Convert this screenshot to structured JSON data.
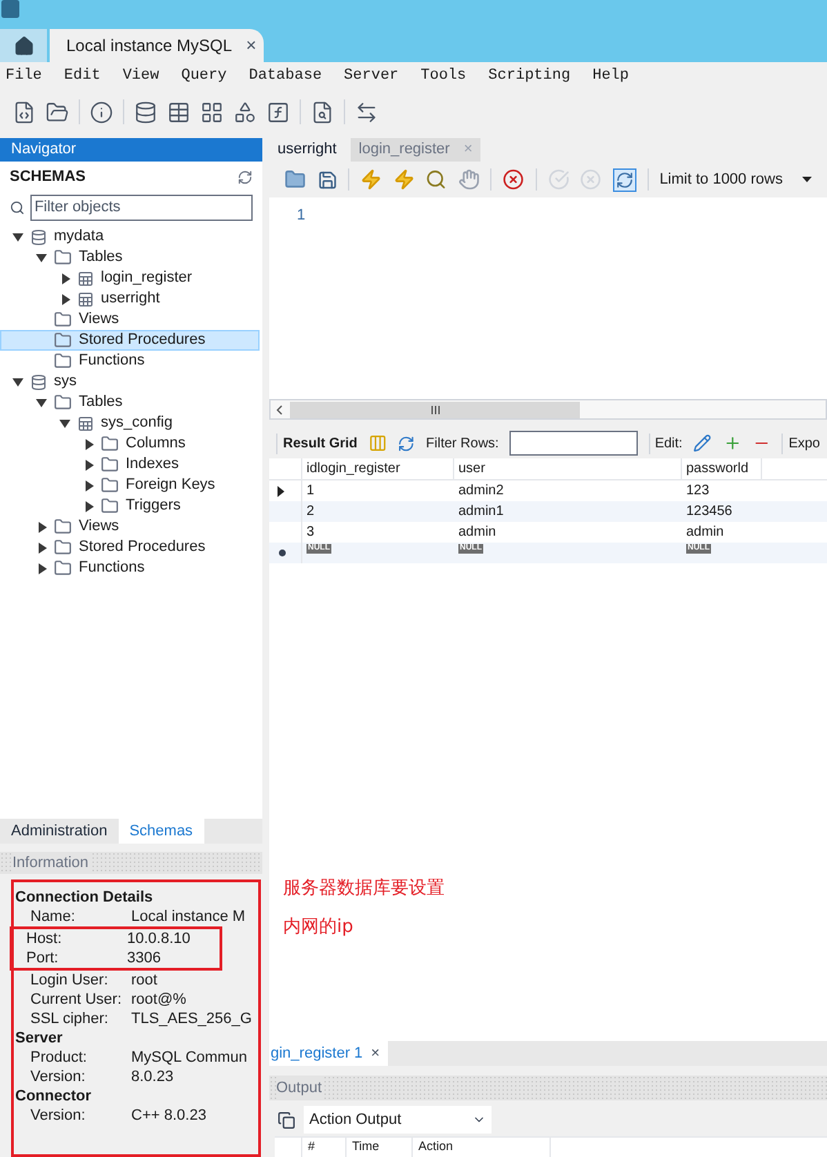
{
  "window": {
    "tabs": [
      {
        "kind": "home",
        "selected": false
      },
      {
        "kind": "doc",
        "label": "Local instance MySQL",
        "close": "×",
        "selected": true
      }
    ]
  },
  "menu": [
    "File",
    "Edit",
    "View",
    "Query",
    "Database",
    "Server",
    "Tools",
    "Scripting",
    "Help"
  ],
  "navigator": {
    "title": "Navigator",
    "schemas_label": "SCHEMAS",
    "filter": {
      "placeholder": "Filter objects"
    },
    "tree": [
      {
        "label": "mydata",
        "kind": "database",
        "expandable": true,
        "expanded": true,
        "selected": false,
        "children": [
          {
            "label": "Tables",
            "kind": "folder",
            "expandable": true,
            "expanded": true,
            "selected": false,
            "children": [
              {
                "label": "login_register",
                "kind": "table",
                "expandable": true,
                "expanded": false,
                "selected": false
              },
              {
                "label": "userright",
                "kind": "table",
                "expandable": true,
                "expanded": false,
                "selected": false
              }
            ]
          },
          {
            "label": "Views",
            "kind": "folder",
            "expandable": false,
            "selected": false
          },
          {
            "label": "Stored Procedures",
            "kind": "folder",
            "expandable": false,
            "selected": true
          },
          {
            "label": "Functions",
            "kind": "folder",
            "expandable": false,
            "selected": false
          }
        ]
      },
      {
        "label": "sys",
        "kind": "database",
        "expandable": true,
        "expanded": true,
        "selected": false,
        "children": [
          {
            "label": "Tables",
            "kind": "folder",
            "expandable": true,
            "expanded": true,
            "selected": false,
            "children": [
              {
                "label": "sys_config",
                "kind": "table",
                "expandable": true,
                "expanded": true,
                "selected": false,
                "children": [
                  {
                    "label": "Columns",
                    "kind": "folder",
                    "expandable": true,
                    "expanded": false,
                    "selected": false
                  },
                  {
                    "label": "Indexes",
                    "kind": "folder",
                    "expandable": true,
                    "expanded": false,
                    "selected": false
                  },
                  {
                    "label": "Foreign Keys",
                    "kind": "folder",
                    "expandable": true,
                    "expanded": false,
                    "selected": false
                  },
                  {
                    "label": "Triggers",
                    "kind": "folder",
                    "expandable": true,
                    "expanded": false,
                    "selected": false
                  }
                ]
              }
            ]
          },
          {
            "label": "Views",
            "kind": "folder",
            "expandable": true,
            "expanded": false,
            "selected": false
          },
          {
            "label": "Stored Procedures",
            "kind": "folder",
            "expandable": true,
            "expanded": false,
            "selected": false
          },
          {
            "label": "Functions",
            "kind": "folder",
            "expandable": true,
            "expanded": false,
            "selected": false
          }
        ]
      }
    ]
  },
  "side_tabs": [
    {
      "label": "Administration",
      "selected": false
    },
    {
      "label": "Schemas",
      "selected": true
    }
  ],
  "information": {
    "title": "Information",
    "sections": [
      {
        "title": "Connection Details",
        "rows": [
          {
            "label": "Name:",
            "value": "Local instance M",
            "annotated": false
          },
          {
            "label": "Host:",
            "value": "10.0.8.10",
            "annotated": true
          },
          {
            "label": "Port:",
            "value": "3306",
            "annotated": true
          },
          {
            "label": "Login User:",
            "value": "root",
            "annotated": false
          },
          {
            "label": "Current User:",
            "value": "root@%",
            "annotated": false
          },
          {
            "label": "SSL cipher:",
            "value": "TLS_AES_256_G",
            "annotated": false
          }
        ]
      },
      {
        "title": "Server",
        "rows": [
          {
            "label": "Product:",
            "value": "MySQL Commun",
            "annotated": false
          },
          {
            "label": "Version:",
            "value": "8.0.23",
            "annotated": false
          }
        ]
      },
      {
        "title": "Connector",
        "rows": [
          {
            "label": "Version:",
            "value": "C++ 8.0.23",
            "annotated": false
          }
        ]
      }
    ]
  },
  "editor_tabs": [
    {
      "label": "userright",
      "selected": true
    },
    {
      "label": "login_register",
      "close": "×",
      "selected": false
    }
  ],
  "editor": {
    "limit": "Limit to 1000 rows",
    "line_numbers": [
      "1"
    ]
  },
  "result_toolbar": {
    "title": "Result Grid",
    "filter_label": "Filter Rows:",
    "edit_label": "Edit:",
    "export_label": "Expo"
  },
  "grid": {
    "columns": [
      "idlogin_register",
      "user",
      "passworld"
    ],
    "rows": [
      {
        "cells": [
          "1",
          "admin2",
          "123"
        ],
        "current": true
      },
      {
        "cells": [
          "2",
          "admin1",
          "123456"
        ],
        "current": false
      },
      {
        "cells": [
          "3",
          "admin",
          "admin"
        ],
        "current": false
      }
    ],
    "new_row": [
      "NULL",
      "NULL",
      "NULL"
    ]
  },
  "annotation": {
    "lines": [
      "服务器数据库要设置",
      "内网的ip"
    ]
  },
  "result_tabs": [
    {
      "label": "gin_register 1",
      "close": "×",
      "selected": true
    }
  ],
  "output": {
    "title": "Output",
    "selector": "Action Output",
    "columns": [
      "#",
      "Time",
      "Action"
    ]
  }
}
